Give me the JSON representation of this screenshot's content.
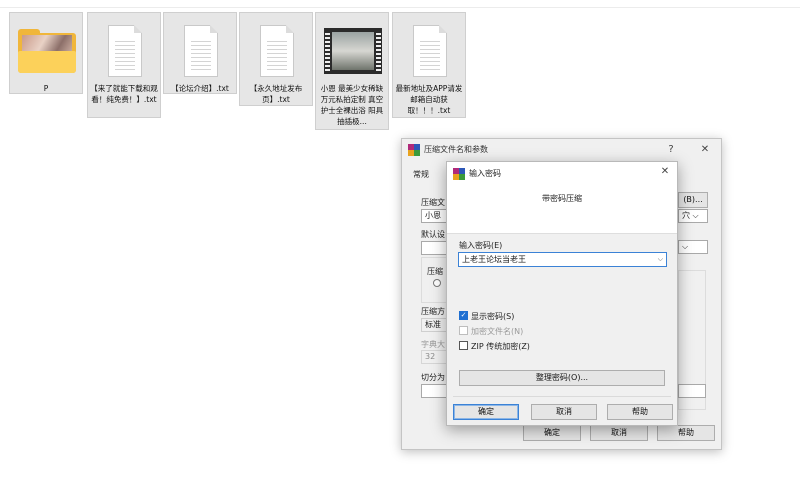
{
  "explorer": {
    "files": [
      {
        "name": "P",
        "kind": "folder"
      },
      {
        "name": "【来了就能下载和观看！纯免费！】.txt",
        "kind": "text"
      },
      {
        "name": "【论坛介绍】.txt",
        "kind": "text"
      },
      {
        "name": "【永久地址发布页】.txt",
        "kind": "text"
      },
      {
        "name": "小恩 最美少女稀缺万元私拍定制 真空护士全裸出浴 阳具抽插极...",
        "kind": "video"
      },
      {
        "name": "最新地址及APP请发邮箱自动获取！！！.txt",
        "kind": "text"
      }
    ]
  },
  "archive_dialog": {
    "title": "压缩文件名和参数",
    "help_glyph": "?",
    "close_glyph": "✕",
    "tab_general": "常规",
    "archive_name_label": "压缩文",
    "archive_name_value": "小恩",
    "browse_label": "(B)...",
    "update_mode_value": "穴",
    "default_profile_label": "默认设",
    "format_label": "压缩",
    "method_label": "压缩方",
    "method_value": "标准",
    "dict_label": "字典大",
    "dict_value": "32",
    "split_label": "切分为",
    "ok_label": "确定",
    "cancel_label": "取消",
    "help_label": "帮助"
  },
  "password_dialog": {
    "title": "输入密码",
    "close_glyph": "✕",
    "heading": "带密码压缩",
    "password_label": "输入密码(E)",
    "password_value": "上老王论坛当老王",
    "show_password": {
      "label": "显示密码(S)",
      "checked": true
    },
    "encrypt_names": {
      "label": "加密文件名(N)",
      "checked": false,
      "disabled": true
    },
    "zip_legacy": {
      "label": "ZIP 传统加密(Z)",
      "checked": false
    },
    "organize_label": "整理密码(O)...",
    "ok_label": "确定",
    "cancel_label": "取消",
    "help_label": "帮助"
  }
}
